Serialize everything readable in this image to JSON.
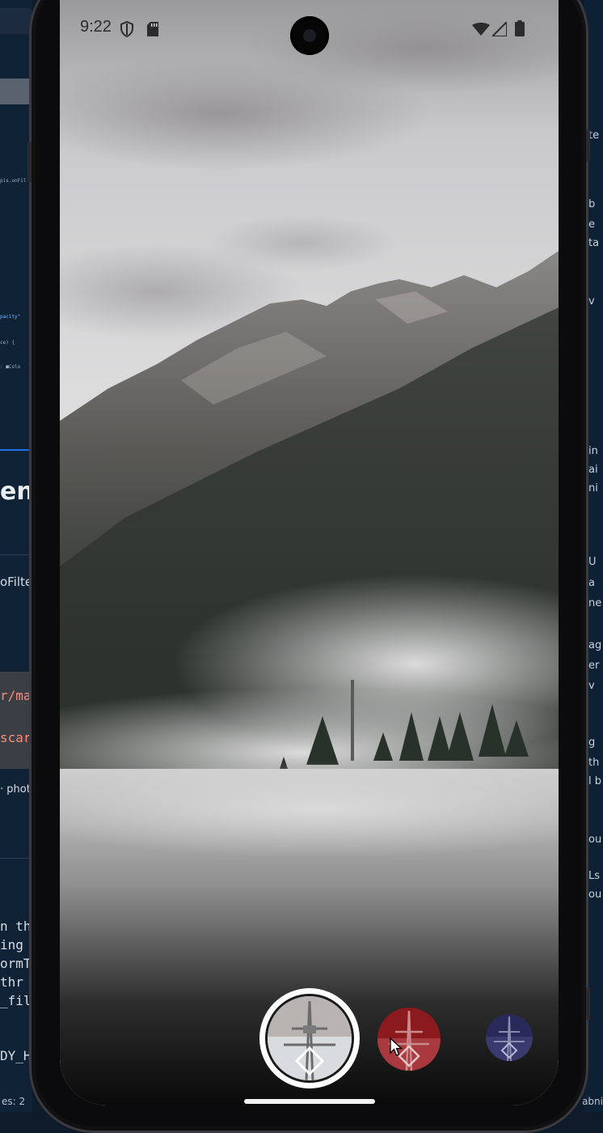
{
  "ide": {
    "left_lines": [
      {
        "text": "pis.onFil",
        "size": 6
      },
      {
        "text": "pacity\"",
        "size": 6
      },
      {
        "text": "ce) {",
        "size": 6
      },
      {
        "text": ": ■Colo",
        "size": 6
      },
      {
        "text": "en",
        "size": 30
      },
      {
        "text": "oFilte",
        "size": 15
      },
      {
        "text": "r/ma",
        "size": 16
      },
      {
        "text": "scard",
        "size": 16
      },
      {
        "text": "· photo",
        "size": 13
      },
      {
        "text": "n the",
        "size": 16
      },
      {
        "text": "ing",
        "size": 16
      },
      {
        "text": "ormT",
        "size": 16
      },
      {
        "text": " thr",
        "size": 16
      },
      {
        "text": "_fil",
        "size": 16
      },
      {
        "text": "DY_H",
        "size": 16
      }
    ],
    "right_lines": [
      "te",
      "b",
      "e",
      "ta",
      "v",
      "in",
      "ai",
      "ni",
      "U",
      "a",
      "ne",
      "ag",
      "er",
      "v",
      "g",
      "th",
      "l b",
      "ou",
      "Ls",
      "ou"
    ],
    "status_left": "es: 2",
    "status_right": "abni"
  },
  "status_bar": {
    "time": "9:22",
    "icons": [
      "shield-icon",
      "sd-card-icon",
      "wifi-icon",
      "signal-icon",
      "battery-icon"
    ]
  },
  "preview": {
    "scene": "misty mountain lake photo"
  },
  "filters": [
    {
      "name": "original",
      "selected": true,
      "tint": "#b8b8b8"
    },
    {
      "name": "red",
      "selected": false,
      "tint": "#8b1a1f"
    },
    {
      "name": "blue",
      "selected": false,
      "tint": "#2a2a5a"
    }
  ],
  "colors": {
    "accent_ring": "#ffffff",
    "red_filter": "#8b1a1f",
    "blue_filter": "#2a2a5a"
  }
}
